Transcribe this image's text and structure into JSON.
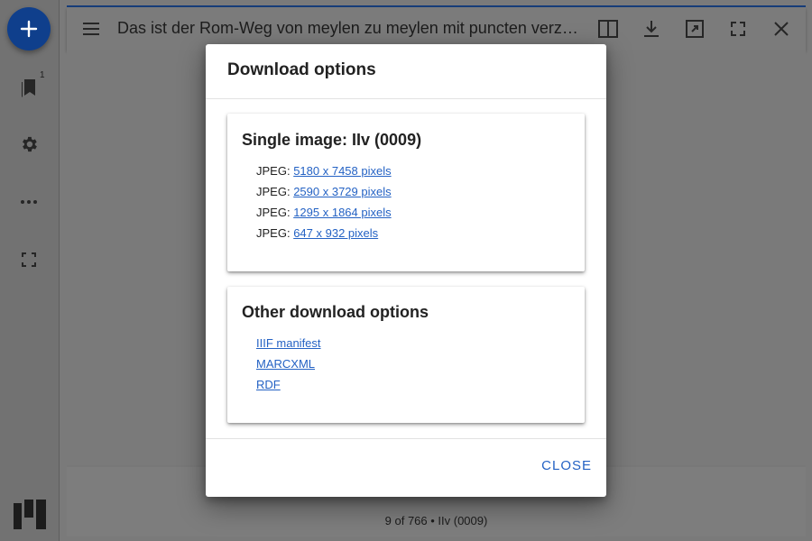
{
  "window": {
    "title": "Das ist der Rom-Weg von meylen zu meylen mit puncten verzeychnet von einer stat zu der andern durch deutzsche lantt",
    "page_info": "9 of 766 • IIv (0009)"
  },
  "sidebar": {
    "bookmarks_badge": "1"
  },
  "dialog": {
    "title": "Download options",
    "single_image": {
      "heading": "Single image: IIv (0009)",
      "items": [
        {
          "format": "JPEG:",
          "label": "5180 x 7458 pixels"
        },
        {
          "format": "JPEG:",
          "label": "2590 x 3729 pixels"
        },
        {
          "format": "JPEG:",
          "label": "1295 x 1864 pixels"
        },
        {
          "format": "JPEG:",
          "label": "647 x 932 pixels"
        }
      ]
    },
    "other": {
      "heading": "Other download options",
      "links": [
        "IIIF manifest",
        "MARCXML",
        "RDF"
      ]
    },
    "close_label": "CLOSE"
  },
  "colors": {
    "accent": "#2462c4",
    "fab": "#0f3f8c"
  },
  "icons": [
    "plus-icon",
    "bookmark-icon",
    "gear-icon",
    "more-horizontal-icon",
    "fullscreen-icon",
    "menu-icon",
    "split-view-icon",
    "download-icon",
    "zoom-fit-icon",
    "fullscreen-toggle-icon",
    "close-icon",
    "logo-icon"
  ]
}
